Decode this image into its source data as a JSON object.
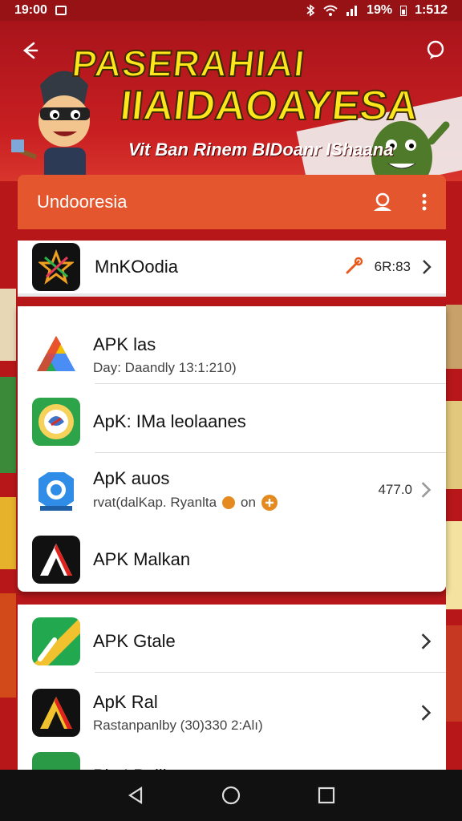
{
  "status_bar": {
    "time": "19:00",
    "battery": "19%",
    "clock_right": "1:512"
  },
  "banner": {
    "title_line1": "PASERAHIAI",
    "title_line2": "IIAIDAOAYESA",
    "subtitle": "Vit Ban Rinem BIDoanr IShaana"
  },
  "header": {
    "title": "Undooresia"
  },
  "top_item": {
    "name": "MnKOodia",
    "value": "6R:83"
  },
  "apps": [
    {
      "name": "APK las",
      "sub": "Day: Daandly 13:1:210)"
    },
    {
      "name": "ApK: IMa leolaanes",
      "sub": ""
    },
    {
      "name": "ApK auos",
      "sub": "rvat(dalKap. Ryanlta",
      "sub_tag": "on",
      "value": "477.0"
    },
    {
      "name": "APK Malkan",
      "sub": ""
    }
  ],
  "apps2": [
    {
      "name": "APK Gtale",
      "sub": ""
    },
    {
      "name": "ApK Ral",
      "sub": "Rastanpanlby (30)330 2:Alı)"
    },
    {
      "name": "Pi : I Paliin",
      "sub": ""
    }
  ],
  "colors": {
    "accent": "#e4572e",
    "banner_red": "#c91f22",
    "title_yellow": "#fde61b"
  },
  "icons": {
    "back": "arrow-left-icon",
    "chat": "chat-bubble-icon",
    "account": "account-icon",
    "more": "more-vert-icon",
    "link": "link-icon",
    "chevron": "chevron-right-icon"
  }
}
